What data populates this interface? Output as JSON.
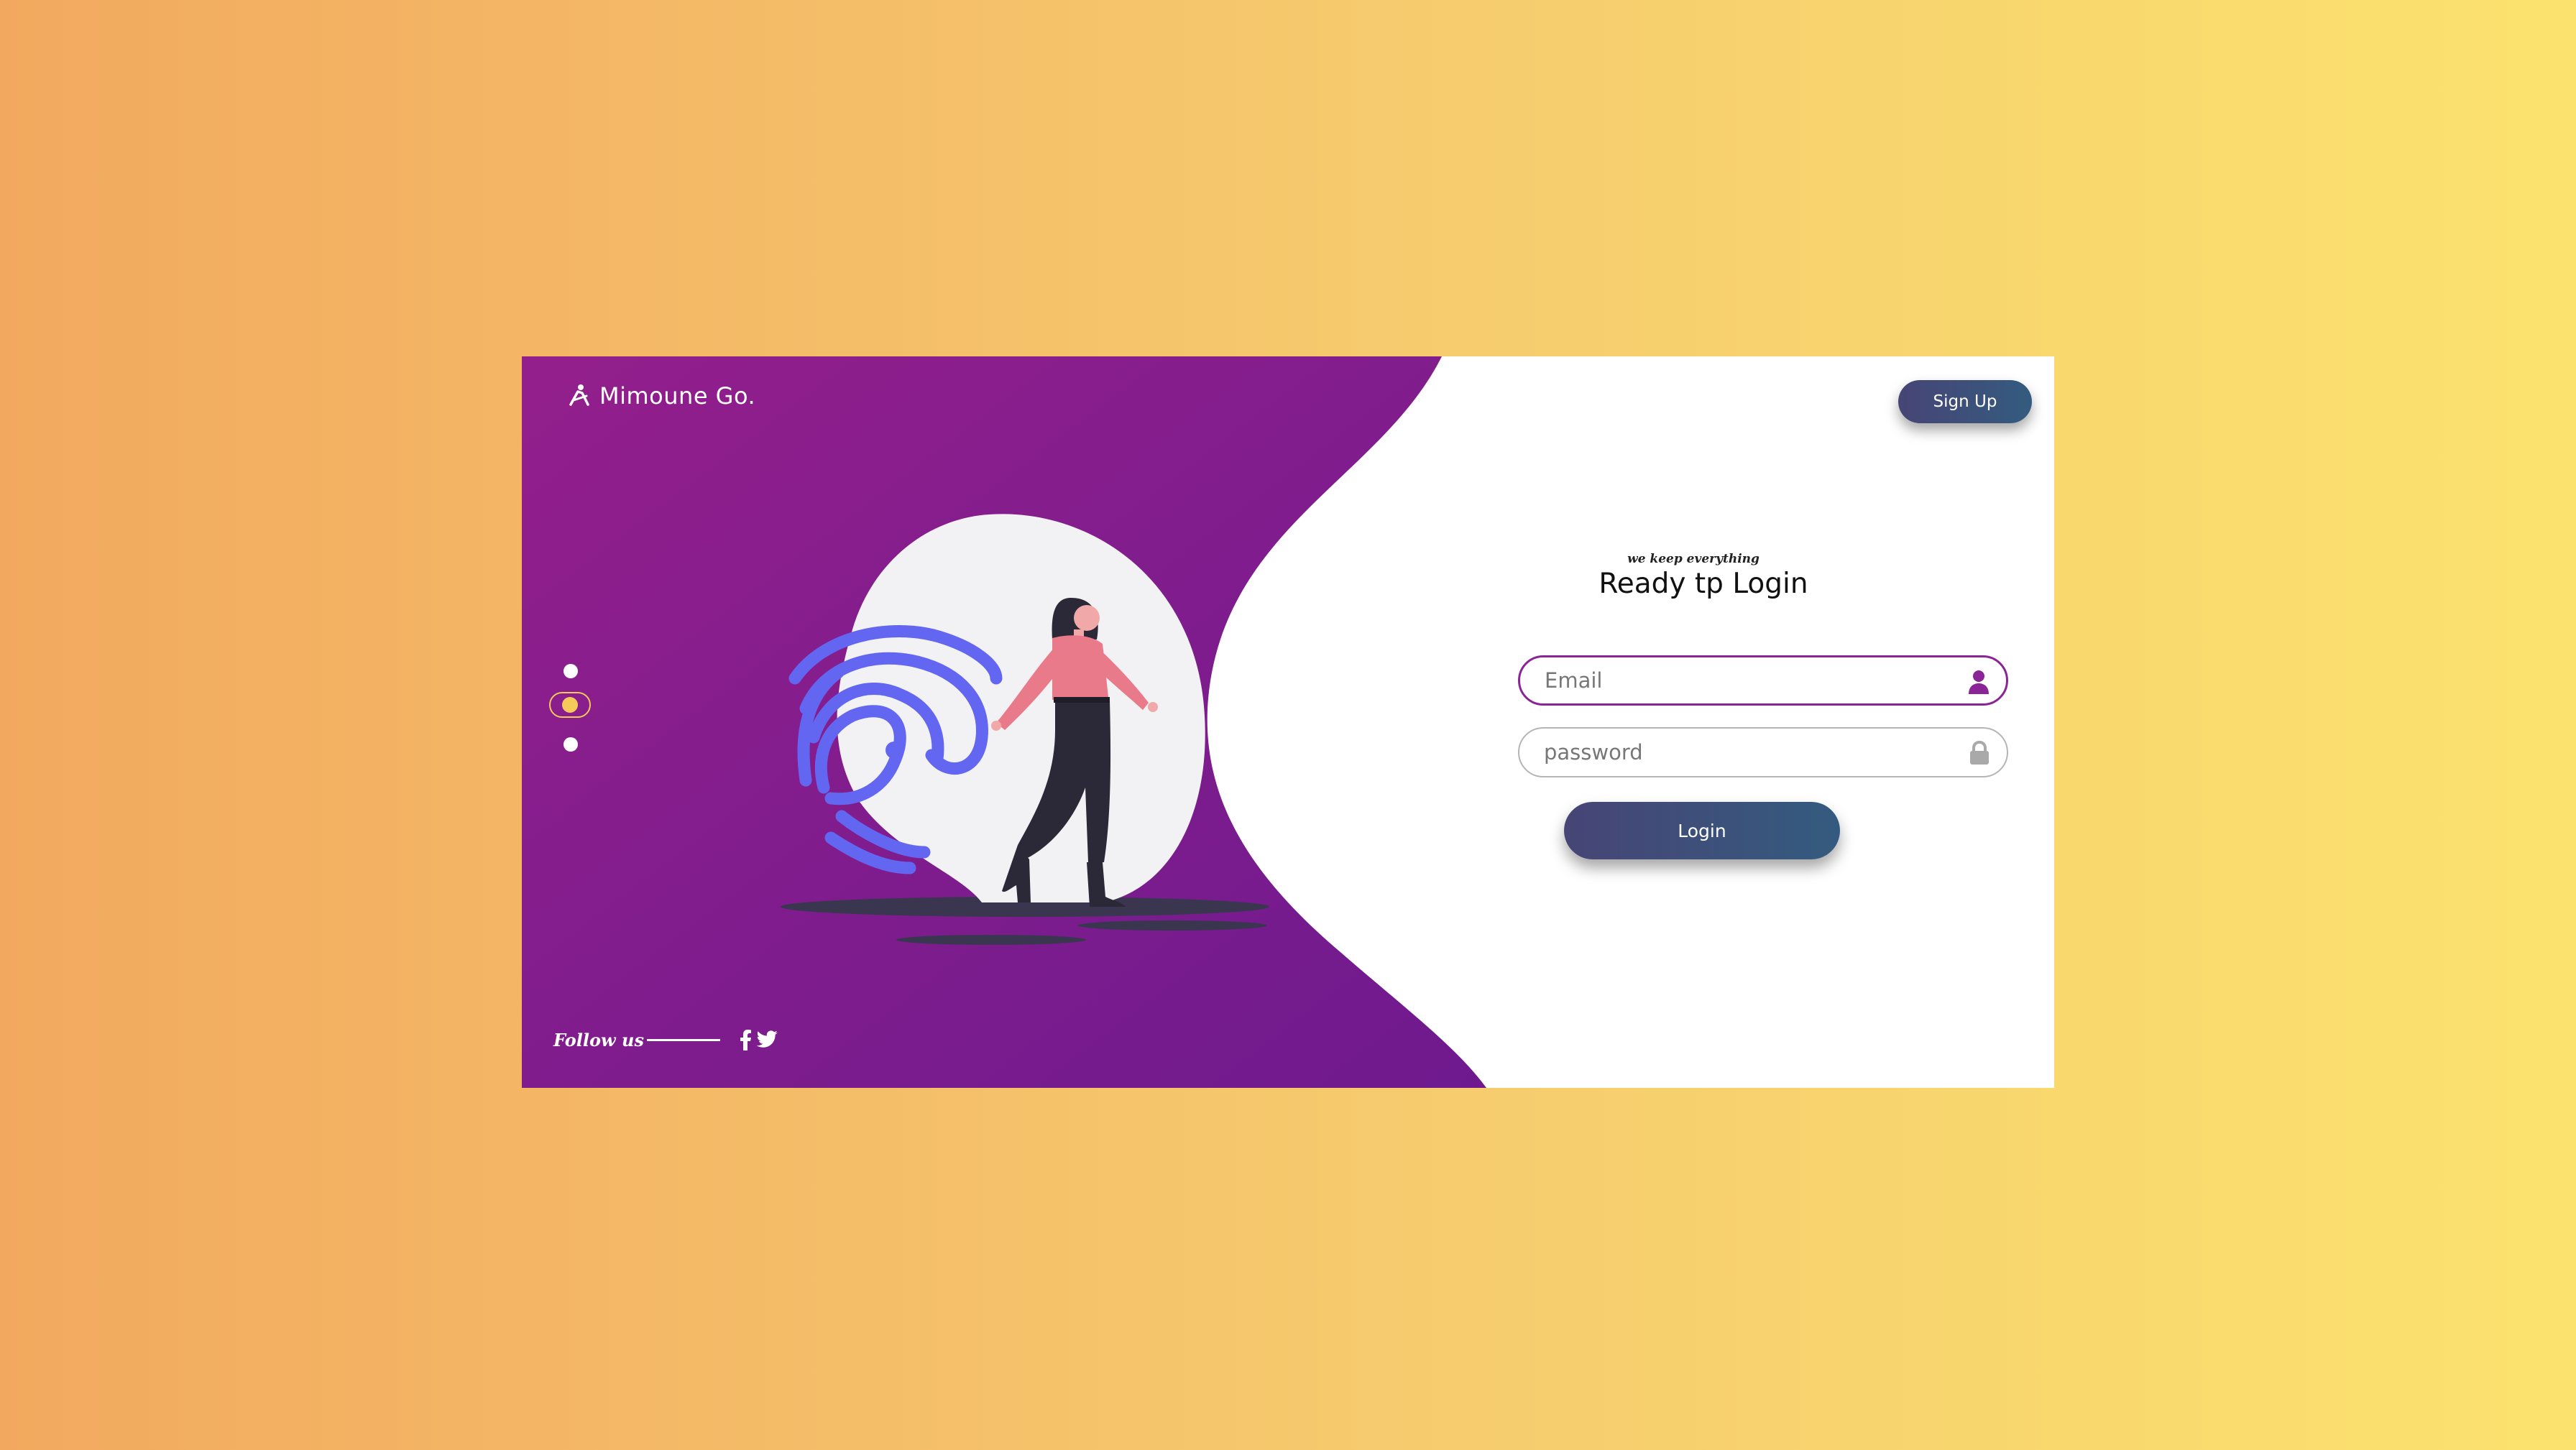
{
  "brand": {
    "name": "Mimoune Go.",
    "icon": "logo-person-icon"
  },
  "header": {
    "signup_label": "Sign Up"
  },
  "hero": {
    "illustration": "fingerprint-woman-illustration",
    "carousel_dots": 3,
    "active_dot": 1
  },
  "footer": {
    "follow_label": "Follow us",
    "social_icons": [
      "facebook-icon",
      "twitter-icon"
    ]
  },
  "login": {
    "eyebrow": "we keep everything",
    "title": "Ready tp Login",
    "email_placeholder": "Email",
    "password_placeholder": "password",
    "submit_label": "Login"
  },
  "colors": {
    "background_start": "#f2a95f",
    "background_end": "#fbe26e",
    "panel_purple": "#8b1f8e",
    "button_gradient_start": "#474575",
    "button_gradient_end": "#345b7f",
    "accent_yellow": "#f5c95a",
    "fingerprint_blue": "#6366f1",
    "figure_pink": "#e97a8a"
  }
}
